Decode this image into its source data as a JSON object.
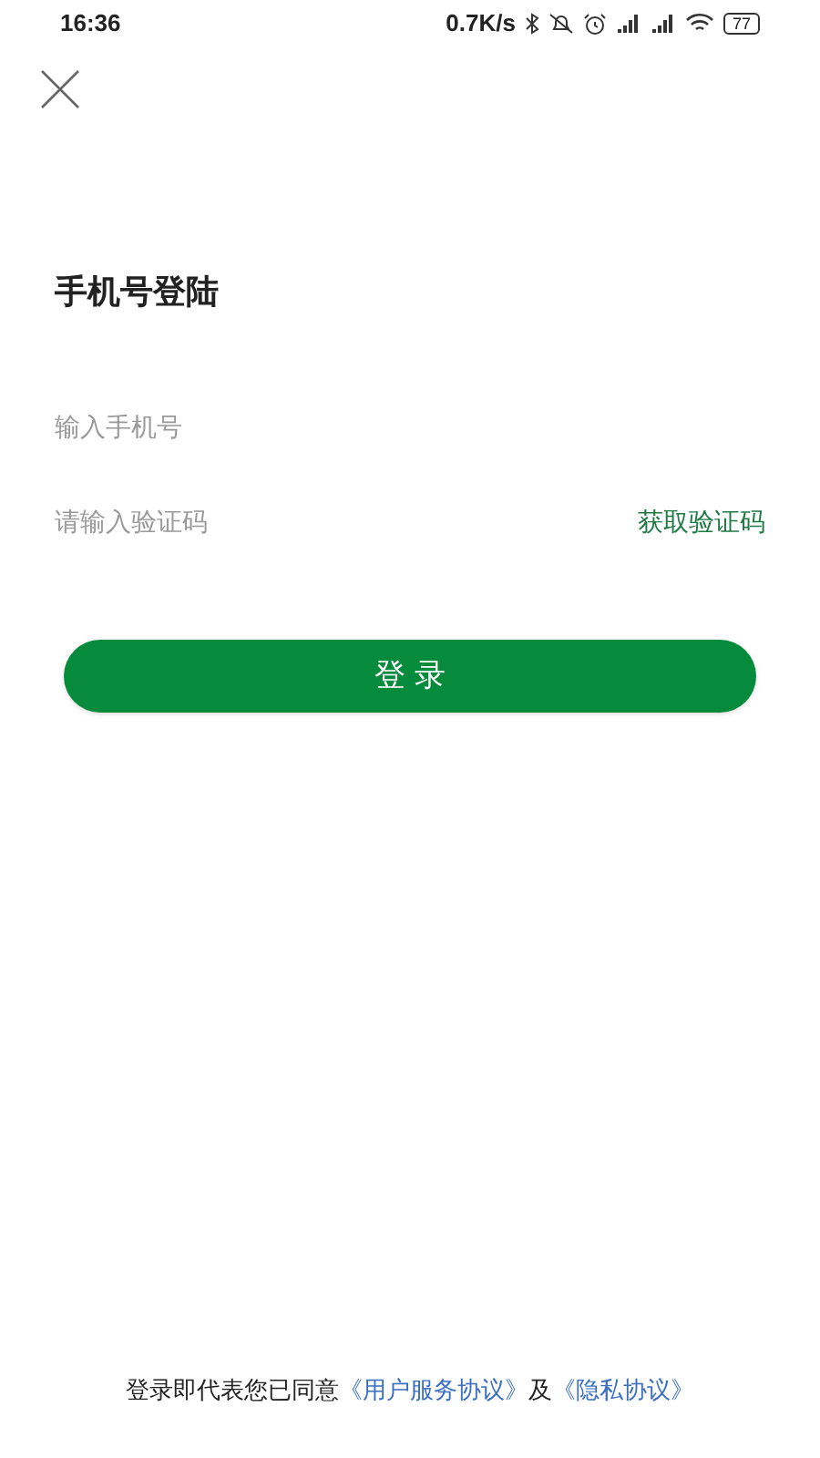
{
  "status_bar": {
    "time": "16:36",
    "speed": "0.7K/s",
    "battery": "77"
  },
  "title": "手机号登陆",
  "phone_field": {
    "placeholder": "输入手机号"
  },
  "code_field": {
    "placeholder": "请输入验证码"
  },
  "get_code_link": "获取验证码",
  "login_button": "登 录",
  "agreement": {
    "text": "登录即代表您已同意",
    "links": [
      "《用户服务协议》",
      "《隐私协议》"
    ],
    "joiner": "及"
  }
}
